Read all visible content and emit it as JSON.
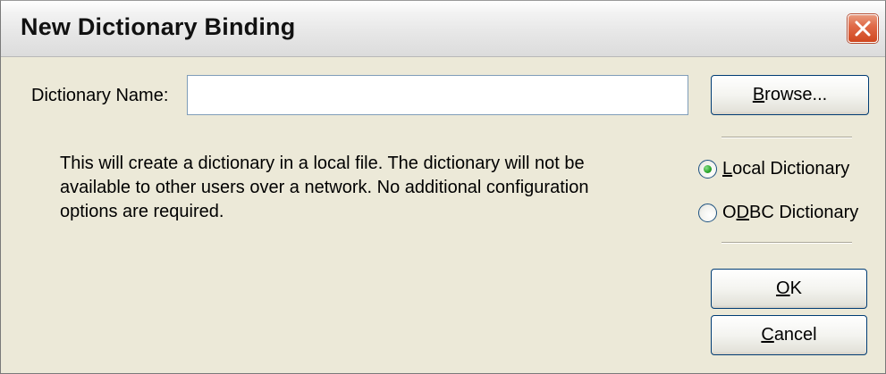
{
  "window": {
    "title": "New Dictionary Binding"
  },
  "form": {
    "dictionary_name_label": "Dictionary Name:",
    "dictionary_name_value": "",
    "description": "This will create a dictionary in a local file. The dictionary will not be available to other users over a network. No additional configuration options are required."
  },
  "buttons": {
    "browse": {
      "mnemonic": "B",
      "rest": "rowse..."
    },
    "ok": {
      "mnemonic": "O",
      "rest": "K"
    },
    "cancel": {
      "mnemonic": "C",
      "rest": "ancel"
    }
  },
  "options": {
    "local": {
      "pre": "",
      "mnemonic": "L",
      "rest": "ocal Dictionary",
      "selected": true
    },
    "odbc": {
      "pre": "O",
      "mnemonic": "D",
      "rest": "BC Dictionary",
      "selected": false
    }
  },
  "icons": {
    "close": "close-icon",
    "radio_selected": "radio-selected-icon",
    "radio_unselected": "radio-unselected-icon"
  },
  "colors": {
    "dialog_bg": "#ece9d8",
    "close_button": "#d0471f",
    "button_border": "#003c74",
    "radio_dot": "#2aa52a"
  }
}
